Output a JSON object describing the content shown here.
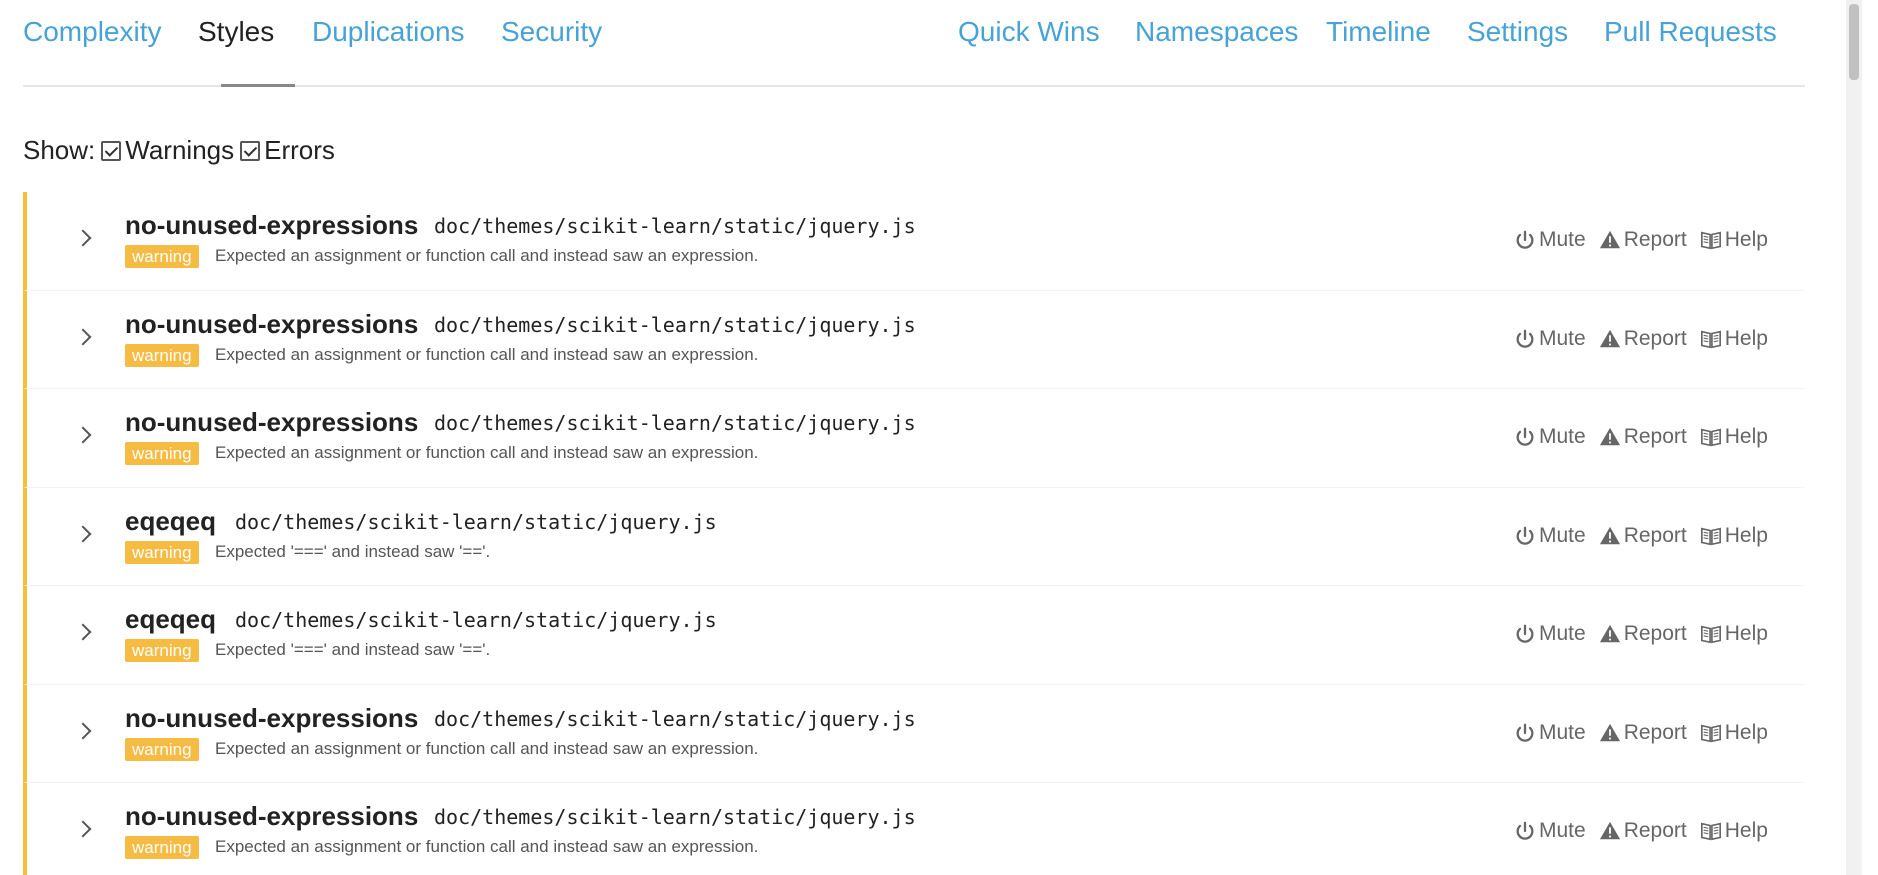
{
  "nav": {
    "left_tabs": [
      "Complexity",
      "Styles",
      "Duplications",
      "Security"
    ],
    "right_tabs": [
      "Quick Wins",
      "Namespaces",
      "Timeline",
      "Settings",
      "Pull Requests"
    ],
    "active_tab": "Styles"
  },
  "filter": {
    "show_label": "Show:",
    "warnings_label": "Warnings",
    "warnings_checked": true,
    "errors_label": "Errors",
    "errors_checked": true
  },
  "issues": [
    {
      "rule": "no-unused-expressions",
      "file": "doc/themes/scikit-learn/static/jquery.js",
      "severity": "warning",
      "message": "Expected an assignment or function call and instead saw an expression."
    },
    {
      "rule": "no-unused-expressions",
      "file": "doc/themes/scikit-learn/static/jquery.js",
      "severity": "warning",
      "message": "Expected an assignment or function call and instead saw an expression."
    },
    {
      "rule": "no-unused-expressions",
      "file": "doc/themes/scikit-learn/static/jquery.js",
      "severity": "warning",
      "message": "Expected an assignment or function call and instead saw an expression."
    },
    {
      "rule": "eqeqeq",
      "file": "doc/themes/scikit-learn/static/jquery.js",
      "severity": "warning",
      "message": "Expected '===' and instead saw '=='."
    },
    {
      "rule": "eqeqeq",
      "file": "doc/themes/scikit-learn/static/jquery.js",
      "severity": "warning",
      "message": "Expected '===' and instead saw '=='."
    },
    {
      "rule": "no-unused-expressions",
      "file": "doc/themes/scikit-learn/static/jquery.js",
      "severity": "warning",
      "message": "Expected an assignment or function call and instead saw an expression."
    },
    {
      "rule": "no-unused-expressions",
      "file": "doc/themes/scikit-learn/static/jquery.js",
      "severity": "warning",
      "message": "Expected an assignment or function call and instead saw an expression."
    }
  ],
  "actions": {
    "mute": "Mute",
    "report": "Report",
    "help": "Help"
  },
  "colors": {
    "link": "#47a3d6",
    "warning": "#f6bb42",
    "border_warning": "#f6bf3a"
  },
  "icons": {
    "mute": "power-icon",
    "report": "warning-triangle-icon",
    "help": "book-icon",
    "expand": "chevron-right-icon"
  }
}
